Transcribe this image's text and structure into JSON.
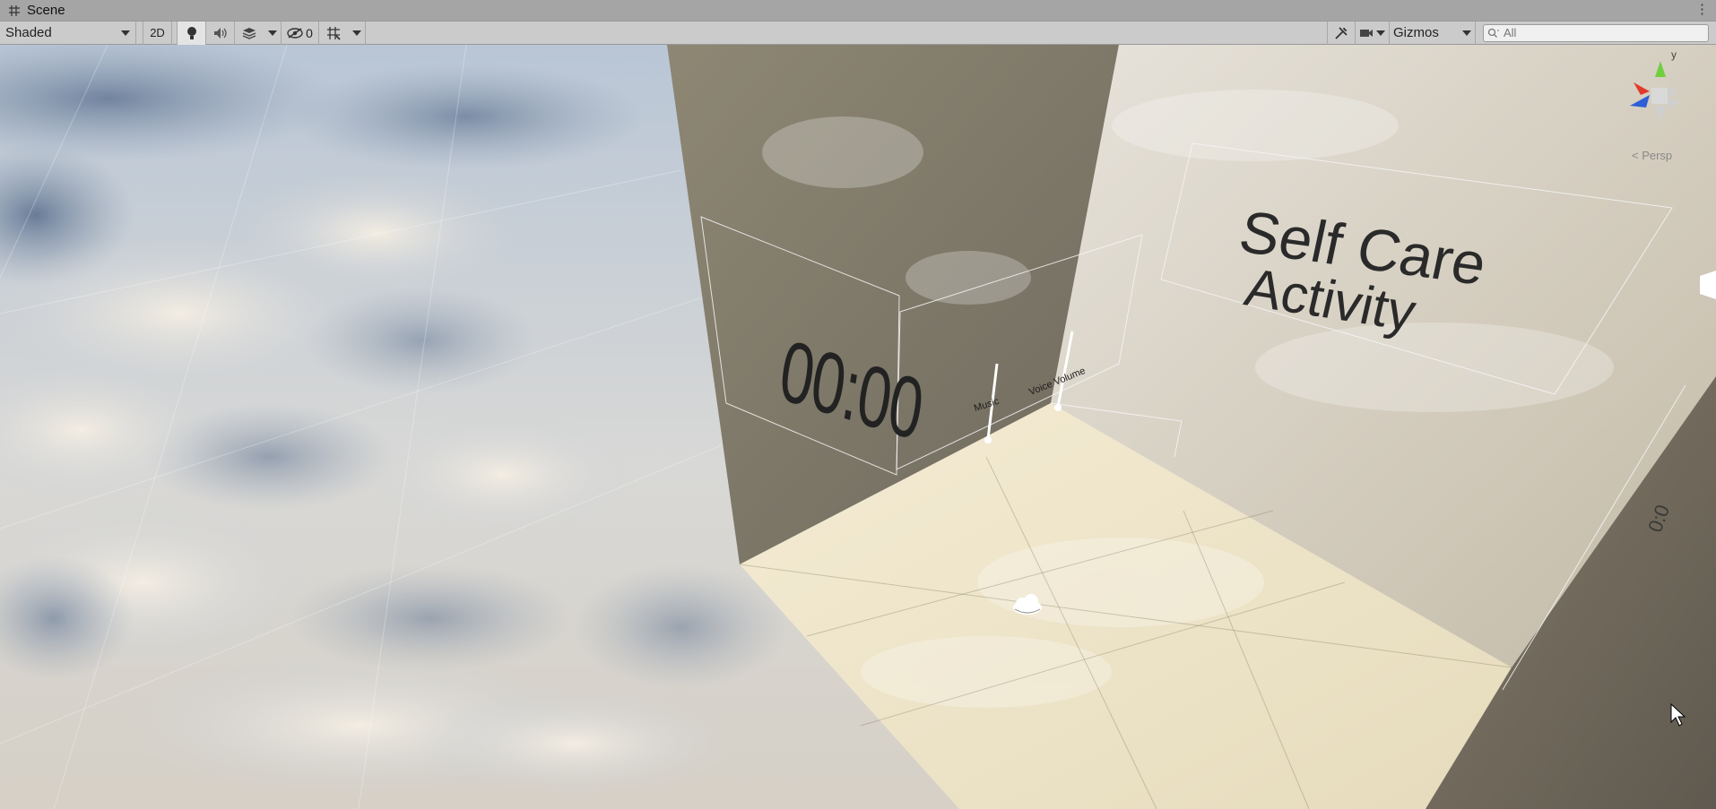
{
  "window": {
    "tab_title": "Scene",
    "menu_icon": "kebab-menu-icon"
  },
  "toolbar": {
    "draw_mode": "Shaded",
    "toggle_2d": "2D",
    "lighting_icon": "lightbulb-icon",
    "audio_icon": "speaker-icon",
    "effects_icon": "layers-icon",
    "hidden_icon": "eye-hidden-icon",
    "hidden_count": "0",
    "grid_icon": "grid-snap-icon",
    "tools_icon": "tools-icon",
    "camera_icon": "camera-icon",
    "gizmos_label": "Gizmos",
    "search_icon": "search-icon",
    "search_placeholder": "All"
  },
  "scene": {
    "timer_text": "00:00",
    "title_line1": "Self Care",
    "title_line2": "Activity",
    "slider_music_label": "Music",
    "slider_voice_label": "Voice Volume",
    "persp_label": "< Persp",
    "axis_y_label": "y",
    "colors": {
      "sky_light": "#e9e2d6",
      "sky_shadow": "#7f8fa8",
      "wall_dark": "#8f8877",
      "floor": "#efe6cd",
      "toolbar": "#cbcbcb",
      "titlebar": "#a5a5a5"
    }
  }
}
